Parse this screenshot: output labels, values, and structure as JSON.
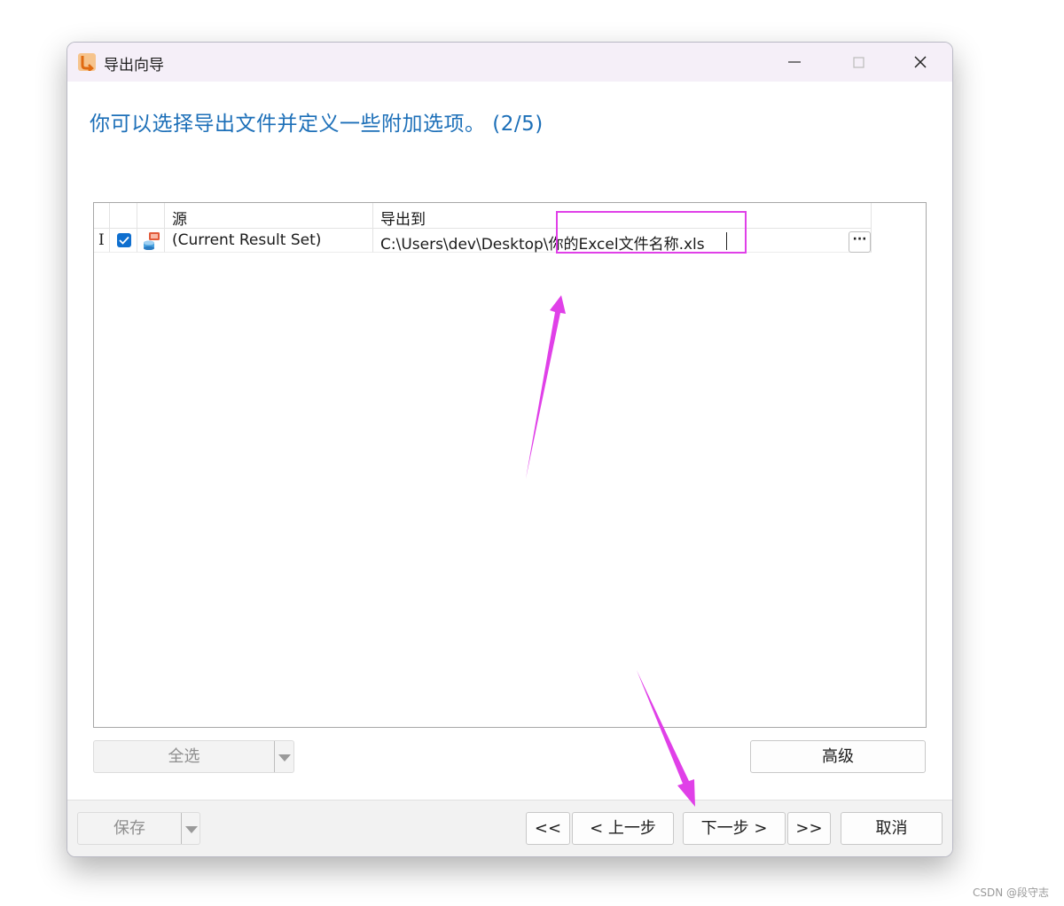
{
  "window": {
    "title": "导出向导",
    "heading": "你可以选择导出文件并定义一些附加选项。 (2/5)"
  },
  "grid": {
    "columns": [
      "源",
      "导出到"
    ],
    "rows": [
      {
        "indicator": "I",
        "checked": true,
        "source": "(Current Result Set)",
        "export_to": "C:\\Users\\dev\\Desktop\\你的Excel文件名称.xls",
        "browse_label": "···"
      }
    ]
  },
  "buttons": {
    "select_all": "全选",
    "advanced": "高级",
    "save": "保存",
    "first": "<<",
    "prev": "< 上一步",
    "next": "下一步 >",
    "last": ">>",
    "cancel": "取消"
  },
  "annotation_color": "#e040e8",
  "accent_color": "#1c6fb8",
  "watermark": "CSDN @段守志"
}
